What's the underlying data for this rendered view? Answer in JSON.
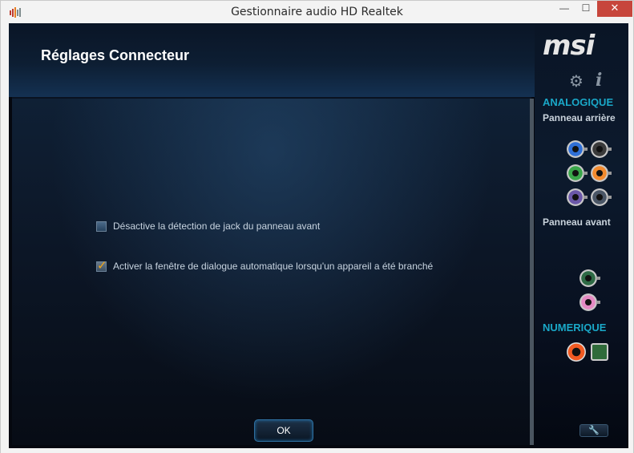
{
  "window": {
    "title": "Gestionnaire audio HD Realtek",
    "minimize_label": "—",
    "maximize_label": "☐",
    "close_label": "✕"
  },
  "header": {
    "page_title": "Réglages Connecteur"
  },
  "options": [
    {
      "label": "Désactive la détection de jack du panneau avant",
      "checked": false
    },
    {
      "label": "Activer la fenêtre de dialogue automatique lorsqu'un appareil a été branché",
      "checked": true
    }
  ],
  "ok_button": {
    "label": "OK"
  },
  "sidebar": {
    "logo": "msi",
    "gear_glyph": "⚙",
    "info_glyph": "i",
    "analog_title": "ANALOGIQUE",
    "rear_panel_label": "Panneau arrière",
    "front_panel_label": "Panneau avant",
    "digital_title": "NUMERIQUE",
    "wrench_glyph": "🔧"
  },
  "jacks": {
    "rear": [
      {
        "name": "jack-rear-blue",
        "color": "#2f6fd6"
      },
      {
        "name": "jack-rear-black",
        "color": "#3a3a3a"
      },
      {
        "name": "jack-rear-green",
        "color": "#3aa64a"
      },
      {
        "name": "jack-rear-orange",
        "color": "#f28a2e"
      },
      {
        "name": "jack-rear-purple",
        "color": "#6a57a8"
      },
      {
        "name": "jack-rear-gray",
        "color": "#4a5666"
      }
    ],
    "front": [
      {
        "name": "jack-front-green",
        "color": "#2e6a45"
      },
      {
        "name": "jack-front-pink",
        "color": "#e58ac3"
      }
    ]
  },
  "colors": {
    "accent_teal": "#1aa8c8",
    "check_orange": "#f2a515",
    "close_red": "#c7463c"
  }
}
